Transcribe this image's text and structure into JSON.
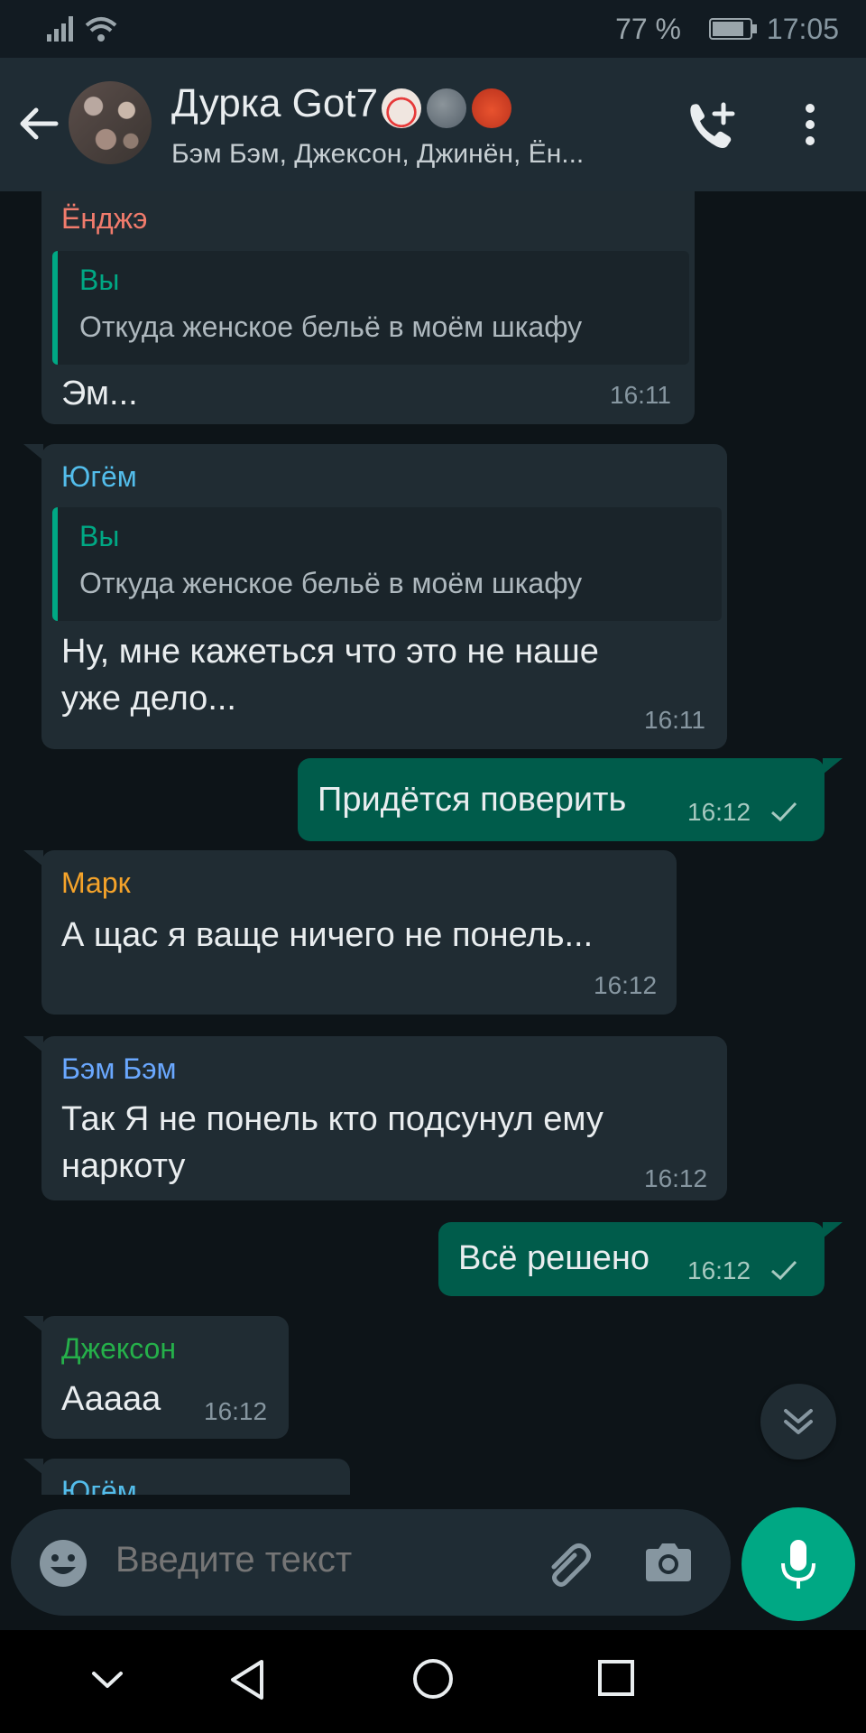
{
  "status_bar": {
    "battery": "77 %",
    "time": "17:05"
  },
  "chat_header": {
    "title": "Дурка Got7",
    "subtitle": "Бэм Бэм, Джексон, Джинён, Ён..."
  },
  "messages": [
    {
      "sender": "Ёнджэ",
      "sender_color": "#f07b6c",
      "quote_name": "Вы",
      "quote_text": "Откуда женское бельё в моём шкафу",
      "text": "Эм...",
      "time": "16:11"
    },
    {
      "sender": "Югём",
      "sender_color": "#53bdeb",
      "quote_name": "Вы",
      "quote_text": "Откуда женское бельё в моём шкафу",
      "text_line1": "Ну,  мне кажеться что это не наше",
      "text_line2": "уже дело...",
      "time": "16:11"
    },
    {
      "text": "Придётся поверить",
      "time": "16:12"
    },
    {
      "sender": "Марк",
      "sender_color": "#f5a32a",
      "text": "А щас я ваще ничего не понель...",
      "time": "16:12"
    },
    {
      "sender": "Бэм Бэм",
      "sender_color": "#6aa8ff",
      "text_line1": "Так  Я не понель кто подсунул ему",
      "text_line2": "наркоту",
      "time": "16:12"
    },
    {
      "text": "Всё решено",
      "time": "16:12"
    },
    {
      "sender": "Джексон",
      "sender_color": "#25b04a",
      "text": "Ааааа",
      "time": "16:12"
    },
    {
      "sender": "Югём",
      "sender_color": "#53bdeb"
    }
  ],
  "input": {
    "placeholder": "Введите текст"
  }
}
